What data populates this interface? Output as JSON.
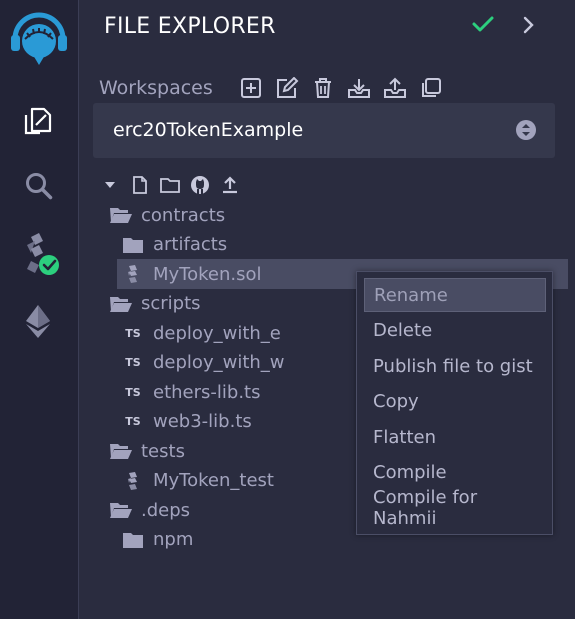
{
  "colors": {
    "accent_blue": "#2a9ad6",
    "check_green": "#2ccf7e",
    "background": "#2a2c3f",
    "sidebar": "#222336"
  },
  "iconbar": {
    "icons": [
      "remix-logo-icon",
      "file-explorer-icon",
      "search-icon",
      "solidity-compiler-icon",
      "deploy-run-icon"
    ]
  },
  "panel": {
    "title": "FILE EXPLORER",
    "workspaces_label": "Workspaces",
    "workspace_selected": "erc20TokenExample"
  },
  "tree": [
    {
      "label": "contracts",
      "icon": "folder-open-icon",
      "depth": 0
    },
    {
      "label": "artifacts",
      "icon": "folder-icon",
      "depth": 1
    },
    {
      "label": "MyToken.sol",
      "icon": "solidity-file-icon",
      "depth": 1,
      "selected": true
    },
    {
      "label": "scripts",
      "icon": "folder-open-icon",
      "depth": 0
    },
    {
      "label": "deploy_with_e",
      "icon": "ts-file-icon",
      "depth": 1
    },
    {
      "label": "deploy_with_w",
      "icon": "ts-file-icon",
      "depth": 1
    },
    {
      "label": "ethers-lib.ts",
      "icon": "ts-file-icon",
      "depth": 1
    },
    {
      "label": "web3-lib.ts",
      "icon": "ts-file-icon",
      "depth": 1
    },
    {
      "label": "tests",
      "icon": "folder-open-icon",
      "depth": 0
    },
    {
      "label": "MyToken_test",
      "icon": "solidity-file-icon",
      "depth": 1
    },
    {
      "label": ".deps",
      "icon": "folder-open-icon",
      "depth": 0
    },
    {
      "label": "npm",
      "icon": "folder-icon",
      "depth": 1
    }
  ],
  "ts_badge": "TS",
  "context_menu": [
    {
      "label": "Rename",
      "highlighted": true
    },
    {
      "label": "Delete"
    },
    {
      "label": "Publish file to gist"
    },
    {
      "label": "Copy"
    },
    {
      "label": "Flatten"
    },
    {
      "label": "Compile"
    },
    {
      "label": "Compile for Nahmii"
    }
  ]
}
